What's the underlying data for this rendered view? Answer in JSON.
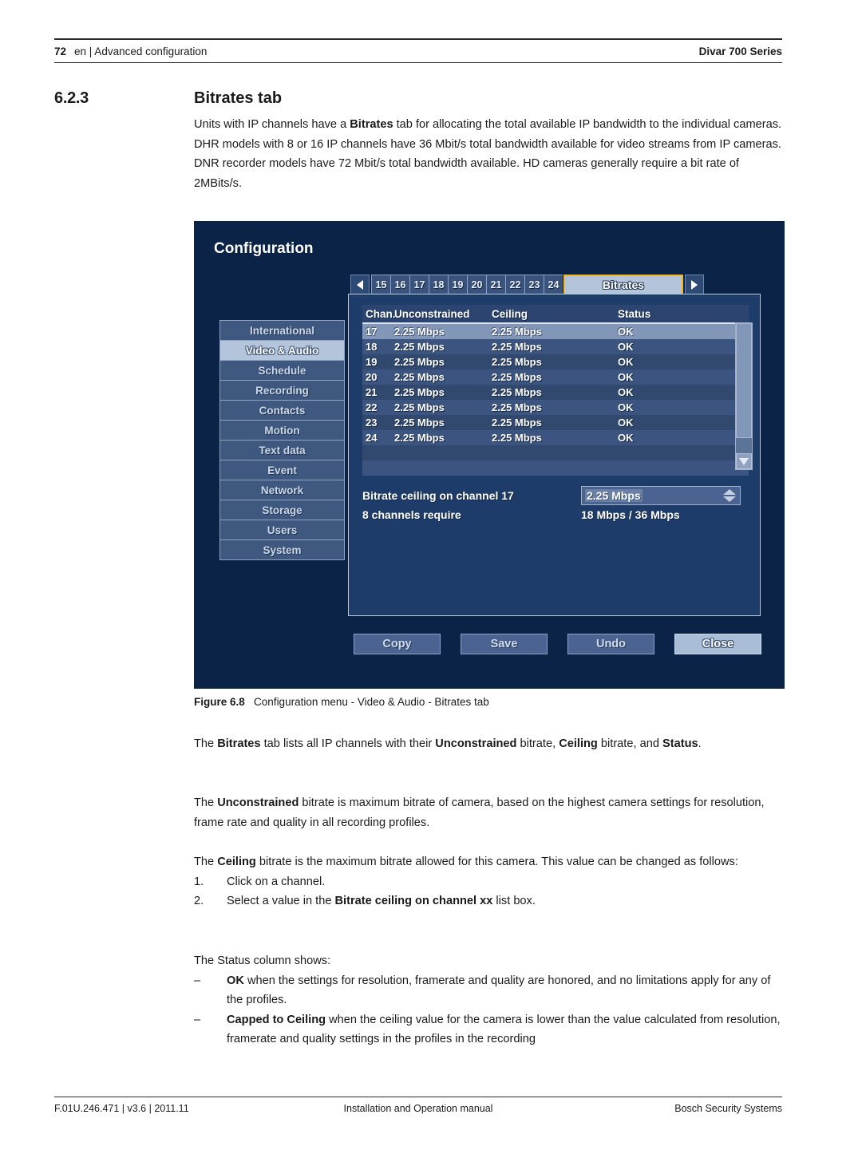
{
  "header": {
    "page_number": "72",
    "breadcrumb": "en | Advanced configuration",
    "product": "Divar 700 Series"
  },
  "section": {
    "number": "6.2.3",
    "title": "Bitrates tab"
  },
  "intro": {
    "line1_a": "Units with IP channels have a ",
    "line1_b": "Bitrates",
    "line1_c": " tab for allocating the total available IP bandwidth to the individual cameras. DHR models with 8 or 16 IP channels have 36 Mbit/s total bandwidth available for video streams from IP cameras. DNR recorder models have 72 Mbit/s total bandwidth available. HD cameras generally require a bit rate of 2MBits/s."
  },
  "figure": {
    "caption_label": "Figure 6.8",
    "caption_text": "Configuration menu - Video & Audio - Bitrates tab",
    "title": "Configuration",
    "tabs": {
      "prev_arrow": "left-arrow-icon",
      "next_arrow": "right-arrow-icon",
      "numbers": [
        "15",
        "16",
        "17",
        "18",
        "19",
        "20",
        "21",
        "22",
        "23",
        "24"
      ],
      "active_tab": "Bitrates"
    },
    "menu": [
      {
        "label": "International",
        "selected": false
      },
      {
        "label": "Video & Audio",
        "selected": true
      },
      {
        "label": "Schedule",
        "selected": false
      },
      {
        "label": "Recording",
        "selected": false
      },
      {
        "label": "Contacts",
        "selected": false
      },
      {
        "label": "Motion",
        "selected": false
      },
      {
        "label": "Text data",
        "selected": false
      },
      {
        "label": "Event",
        "selected": false
      },
      {
        "label": "Network",
        "selected": false
      },
      {
        "label": "Storage",
        "selected": false
      },
      {
        "label": "Users",
        "selected": false
      },
      {
        "label": "System",
        "selected": false
      }
    ],
    "table": {
      "columns": [
        "Chan.",
        "Unconstrained",
        "Ceiling",
        "Status"
      ],
      "rows": [
        {
          "chan": "17",
          "unconstrained": "2.25 Mbps",
          "ceiling": "2.25 Mbps",
          "status": "OK",
          "selected": true
        },
        {
          "chan": "18",
          "unconstrained": "2.25 Mbps",
          "ceiling": "2.25 Mbps",
          "status": "OK",
          "selected": false
        },
        {
          "chan": "19",
          "unconstrained": "2.25 Mbps",
          "ceiling": "2.25 Mbps",
          "status": "OK",
          "selected": false
        },
        {
          "chan": "20",
          "unconstrained": "2.25 Mbps",
          "ceiling": "2.25 Mbps",
          "status": "OK",
          "selected": false
        },
        {
          "chan": "21",
          "unconstrained": "2.25 Mbps",
          "ceiling": "2.25 Mbps",
          "status": "OK",
          "selected": false
        },
        {
          "chan": "22",
          "unconstrained": "2.25 Mbps",
          "ceiling": "2.25 Mbps",
          "status": "OK",
          "selected": false
        },
        {
          "chan": "23",
          "unconstrained": "2.25 Mbps",
          "ceiling": "2.25 Mbps",
          "status": "OK",
          "selected": false
        },
        {
          "chan": "24",
          "unconstrained": "2.25 Mbps",
          "ceiling": "2.25 Mbps",
          "status": "OK",
          "selected": false
        }
      ]
    },
    "ceiling_control": {
      "label": "Bitrate ceiling on channel 17",
      "value": "2.25 Mbps"
    },
    "requirement": {
      "label": "8 channels require",
      "value": "18 Mbps / 36 Mbps"
    },
    "buttons": [
      {
        "label": "Copy",
        "primary": false
      },
      {
        "label": "Save",
        "primary": false
      },
      {
        "label": "Undo",
        "primary": false
      },
      {
        "label": "Close",
        "primary": true
      }
    ],
    "colors": {
      "window_background": "#0b2347",
      "panel_background": "#1d3c69",
      "accent_highlight": "#f4b81f",
      "selection": "#b4c4da"
    }
  },
  "body": {
    "lists_para": {
      "a": "The ",
      "b": "Bitrates",
      "c": " tab lists all IP channels with their ",
      "d": "Unconstrained",
      "e": " bitrate, ",
      "f": "Ceiling",
      "g": " bitrate, and ",
      "h": "Status",
      "i": "."
    },
    "unconstrained_para": {
      "a": "The ",
      "b": "Unconstrained",
      "c": " bitrate is maximum bitrate of camera, based on the highest camera settings for resolution, frame rate and quality in all recording profiles."
    },
    "ceiling_para": {
      "a": "The ",
      "b": "Ceiling",
      "c": " bitrate is the maximum bitrate allowed for this camera. This value can be changed as follows:"
    },
    "ceiling_steps": [
      {
        "marker": "1.",
        "text": "Click on a channel."
      },
      {
        "marker": "2.",
        "pre": "Select a value in the ",
        "bold": "Bitrate ceiling on channel xx",
        "post": " list box."
      }
    ],
    "status_intro": "The Status column shows:",
    "status_items": [
      {
        "marker": "–",
        "bold": "OK",
        "text": " when the settings for resolution, framerate and quality are honored, and no limitations apply for any of the profiles."
      },
      {
        "marker": "–",
        "bold": "Capped to Ceiling",
        "text": " when the ceiling value for the camera is lower than the value calculated from resolution, framerate and quality settings in the profiles in the recording"
      }
    ]
  },
  "footer": {
    "left": "F.01U.246.471 | v3.6 | 2011.11",
    "center": "Installation and Operation manual",
    "right": "Bosch Security Systems"
  }
}
